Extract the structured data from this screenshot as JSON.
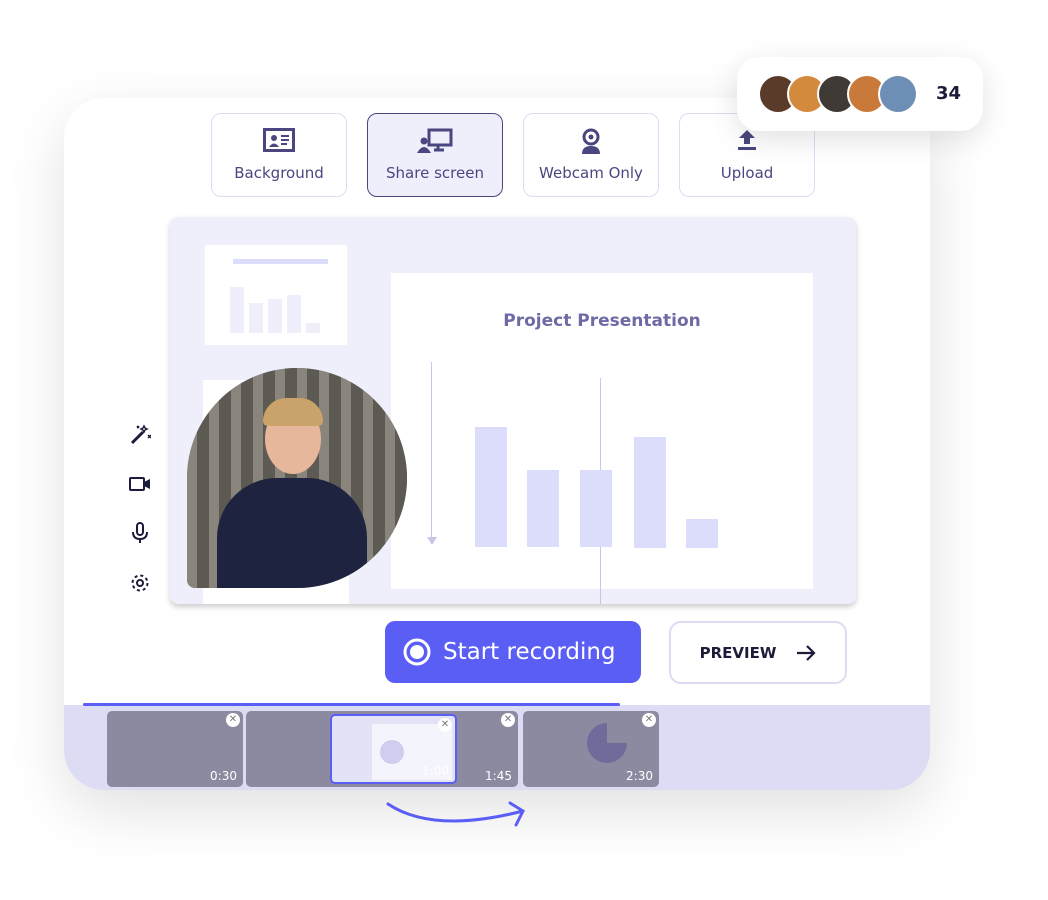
{
  "modes": [
    {
      "label": "Background",
      "icon": "contact-card-icon"
    },
    {
      "label": "Share screen",
      "icon": "share-screen-icon",
      "active": true
    },
    {
      "label": "Webcam Only",
      "icon": "webcam-icon"
    },
    {
      "label": "Upload",
      "icon": "upload-icon"
    }
  ],
  "viewers": {
    "count": "34"
  },
  "slide": {
    "title": "Project Presentation"
  },
  "side_tools": [
    "magic-wand-icon",
    "camera-icon",
    "microphone-icon",
    "gear-icon"
  ],
  "actions": {
    "start_recording": "Start recording",
    "preview": "PREVIEW"
  },
  "timeline": {
    "progress_percent": 62,
    "clips": [
      {
        "time": "0:30"
      },
      {
        "time": "1:45"
      },
      {
        "time": "2:30"
      }
    ],
    "dragging": {
      "time": "1:00"
    }
  },
  "colors": {
    "accent": "#5b5ef4",
    "text": "#4a4780",
    "band": "#dcdcf4"
  }
}
